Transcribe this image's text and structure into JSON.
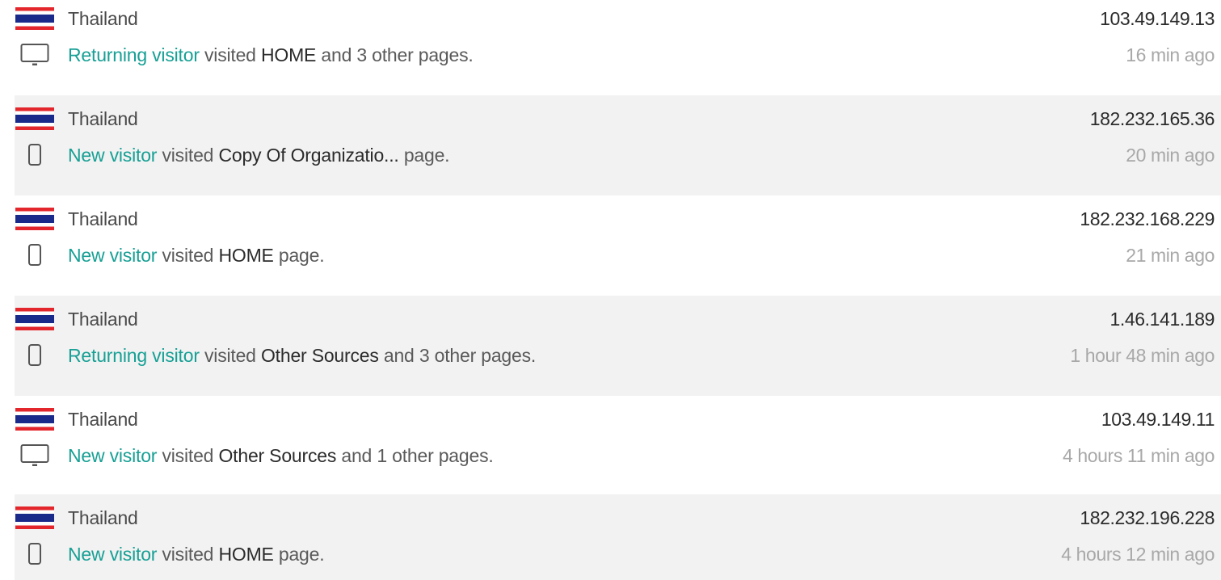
{
  "colors": {
    "accent": "#17a095",
    "row_alt_bg": "#f2f2f2",
    "timestamp": "#a8a8a8"
  },
  "visits": [
    {
      "flag_icon": "thailand-flag-icon",
      "country": "Thailand",
      "ip": "103.49.149.13",
      "device_icon": "desktop-icon",
      "visitor_type": "Returning visitor",
      "verb": "visited",
      "page": "HOME",
      "suffix": "and 3 other pages.",
      "time": "16 min ago"
    },
    {
      "flag_icon": "thailand-flag-icon",
      "country": "Thailand",
      "ip": "182.232.165.36",
      "device_icon": "mobile-icon",
      "visitor_type": "New visitor",
      "verb": "visited",
      "page": "Copy Of Organizatio...",
      "suffix": "page.",
      "time": "20 min ago"
    },
    {
      "flag_icon": "thailand-flag-icon",
      "country": "Thailand",
      "ip": "182.232.168.229",
      "device_icon": "mobile-icon",
      "visitor_type": "New visitor",
      "verb": "visited",
      "page": "HOME",
      "suffix": "page.",
      "time": "21 min ago"
    },
    {
      "flag_icon": "thailand-flag-icon",
      "country": "Thailand",
      "ip": "1.46.141.189",
      "device_icon": "mobile-icon",
      "visitor_type": "Returning visitor",
      "verb": "visited",
      "page": "Other Sources",
      "suffix": "and 3 other pages.",
      "time": "1 hour 48 min ago"
    },
    {
      "flag_icon": "thailand-flag-icon",
      "country": "Thailand",
      "ip": "103.49.149.11",
      "device_icon": "desktop-icon",
      "visitor_type": "New visitor",
      "verb": "visited",
      "page": "Other Sources",
      "suffix": "and 1 other pages.",
      "time": "4 hours 11 min ago"
    },
    {
      "flag_icon": "thailand-flag-icon",
      "country": "Thailand",
      "ip": "182.232.196.228",
      "device_icon": "mobile-icon",
      "visitor_type": "New visitor",
      "verb": "visited",
      "page": "HOME",
      "suffix": "page.",
      "time": "4 hours 12 min ago"
    }
  ]
}
